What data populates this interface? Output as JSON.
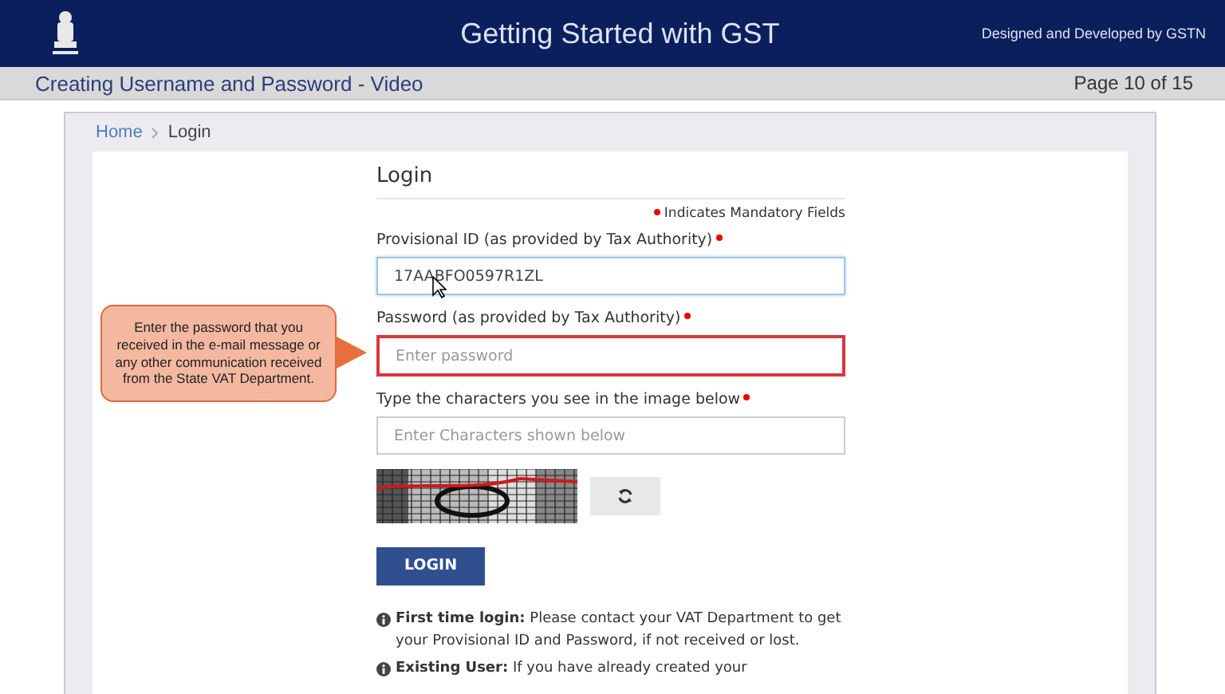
{
  "header": {
    "title": "Getting Started with GST",
    "credit": "Designed and Developed by GSTN"
  },
  "subheader": {
    "title": "Creating Username and Password - Video",
    "page": "Page 10 of 15"
  },
  "breadcrumb": [
    {
      "label": "Home",
      "kind": "link"
    },
    {
      "label": "Login",
      "kind": "current"
    }
  ],
  "login": {
    "heading": "Login",
    "mandatory_note": "Indicates Mandatory Fields",
    "fields": [
      {
        "label": "Provisional ID (as provided by Tax Authority)",
        "value": "17AABFO0597R1ZL",
        "highlighted": false,
        "focused": true
      },
      {
        "label": "Password (as provided by Tax Authority)",
        "placeholder": "Enter password",
        "highlighted": true,
        "focused": false
      },
      {
        "label": "Type the characters you see in the image below",
        "placeholder": "Enter Characters shown below",
        "highlighted": false,
        "focused": false
      }
    ],
    "captcha": {
      "kind": "picture"
    },
    "button": "LOGIN",
    "notes": [
      "**First time login:** Please contact your VAT Department to get your Provisional ID and Password, if not received or lost.",
      "**Existing User:** If you have already created your"
    ]
  },
  "callout": {
    "text": "Enter the password that you received in the e-mail message or any other communication received from the State VAT Department."
  }
}
